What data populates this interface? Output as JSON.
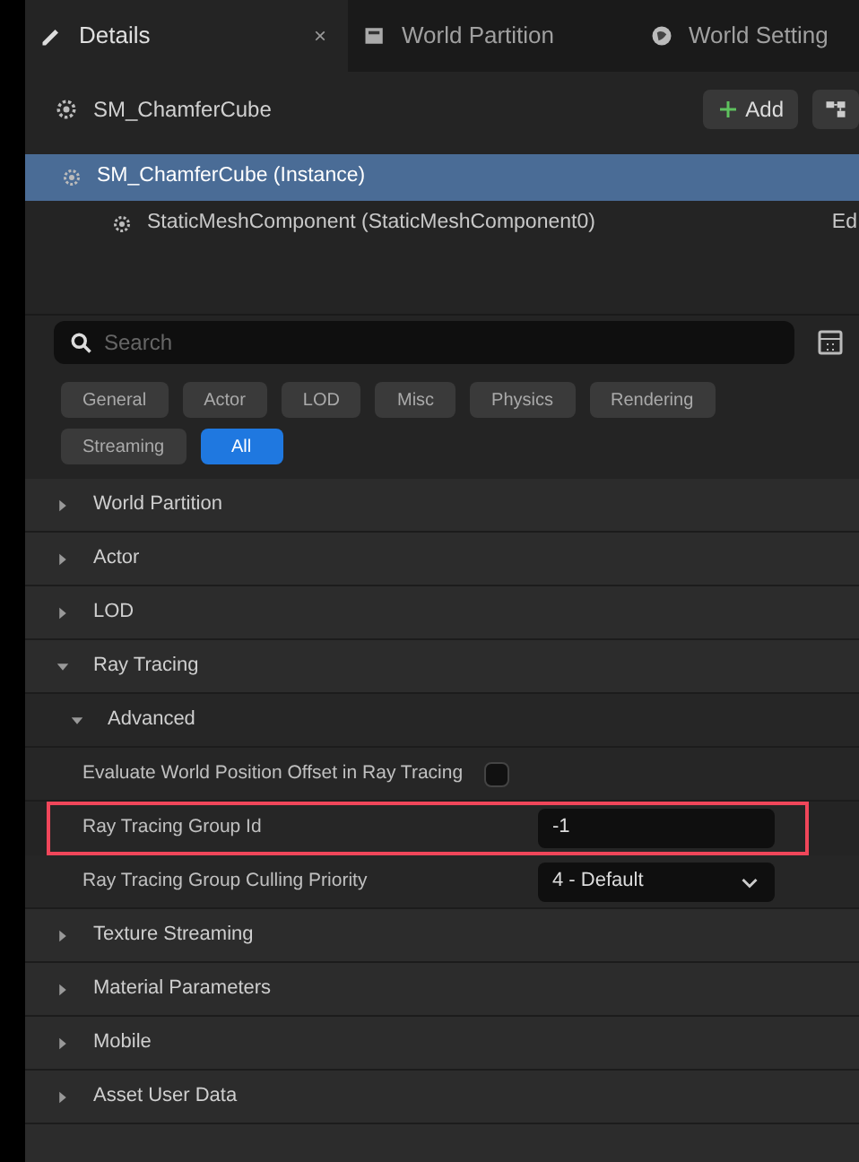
{
  "tabs": [
    {
      "label": "Details",
      "selected": true,
      "close": "×"
    },
    {
      "label": "World Partition",
      "selected": false
    },
    {
      "label": "World Setting",
      "selected": false
    }
  ],
  "actor": {
    "name": "SM_ChamferCube",
    "add_button": "Add"
  },
  "components": [
    {
      "label": "SM_ChamferCube (Instance)",
      "selected": true,
      "children": [
        {
          "label": "StaticMeshComponent (StaticMeshComponent0)",
          "selected": false,
          "extra": "Ed"
        }
      ]
    }
  ],
  "search": {
    "placeholder": "Search"
  },
  "filters": [
    {
      "label": "General",
      "selected": false
    },
    {
      "label": "Actor",
      "selected": false
    },
    {
      "label": "LOD",
      "selected": false
    },
    {
      "label": "Misc",
      "selected": false
    },
    {
      "label": "Physics",
      "selected": false
    },
    {
      "label": "Rendering",
      "selected": false
    },
    {
      "label": "Streaming",
      "selected": false
    },
    {
      "label": "All",
      "selected": true
    }
  ],
  "sections": [
    {
      "label": "World Partition",
      "expanded": false
    },
    {
      "label": "Actor",
      "expanded": false
    },
    {
      "label": "LOD",
      "expanded": false
    },
    {
      "label": "Ray Tracing",
      "expanded": true,
      "children": [
        {
          "label": "Advanced",
          "expanded": true,
          "properties": [
            {
              "label": "Evaluate World Position Offset in Ray Tracing",
              "kind": "checkbox",
              "checked": false,
              "highlighted": false
            },
            {
              "label": "Ray Tracing Group Id",
              "kind": "number",
              "value": "-1",
              "highlighted": true
            },
            {
              "label": "Ray Tracing Group Culling Priority",
              "kind": "dropdown",
              "value": "4 - Default",
              "highlighted": false
            }
          ]
        }
      ]
    },
    {
      "label": "Texture Streaming",
      "expanded": false
    },
    {
      "label": "Material Parameters",
      "expanded": false
    },
    {
      "label": "Mobile",
      "expanded": false
    },
    {
      "label": "Asset User Data",
      "expanded": false
    }
  ]
}
